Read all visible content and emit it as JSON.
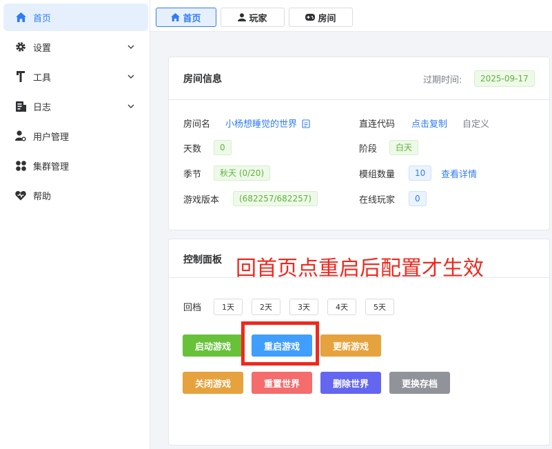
{
  "sidebar": {
    "items": [
      {
        "label": "首页",
        "icon": "home-icon"
      },
      {
        "label": "设置",
        "icon": "gear-icon"
      },
      {
        "label": "工具",
        "icon": "tool-icon"
      },
      {
        "label": "日志",
        "icon": "log-icon"
      },
      {
        "label": "用户管理",
        "icon": "user-gear-icon"
      },
      {
        "label": "集群管理",
        "icon": "cluster-icon"
      },
      {
        "label": "帮助",
        "icon": "heart-icon"
      }
    ]
  },
  "tabs": [
    {
      "label": "首页",
      "icon": "home-icon"
    },
    {
      "label": "玩家",
      "icon": "user-icon"
    },
    {
      "label": "房间",
      "icon": "gamepad-icon"
    }
  ],
  "room_card": {
    "title": "房间信息",
    "expire_label": "过期时间:",
    "expire_value": "2025-09-17",
    "room_name_label": "房间名",
    "room_name_value": "小杨想睡觉的世界",
    "direct_code_label": "直连代码",
    "direct_code_copy": "点击复制",
    "direct_code_custom": "自定义",
    "days_label": "天数",
    "days_value": "0",
    "phase_label": "阶段",
    "phase_value": "白天",
    "season_label": "季节",
    "season_value": "秋天 (0/20)",
    "mod_count_label": "模组数量",
    "mod_count_value": "10",
    "mod_details_link": "查看详情",
    "version_label": "游戏版本",
    "version_value": "(682257/682257)",
    "online_label": "在线玩家",
    "online_value": "0"
  },
  "control_card": {
    "title": "控制面板",
    "rollback_label": "回档",
    "rollback_days": [
      "1天",
      "2天",
      "3天",
      "4天",
      "5天"
    ],
    "buttons": {
      "start": "启动游戏",
      "restart": "重启游戏",
      "update": "更新游戏",
      "shutdown": "关闭游戏",
      "reset": "重置世界",
      "delete": "删除世界",
      "swap_save": "更换存档"
    }
  },
  "annotation_text": "回首页点重启后配置才生效",
  "colors": {
    "primary": "#2f7cf6",
    "success": "#67c23a",
    "warning": "#e6a23c",
    "danger": "#f56c6c",
    "purple": "#6366f1",
    "gray": "#909399",
    "annotation": "#f0281e"
  }
}
